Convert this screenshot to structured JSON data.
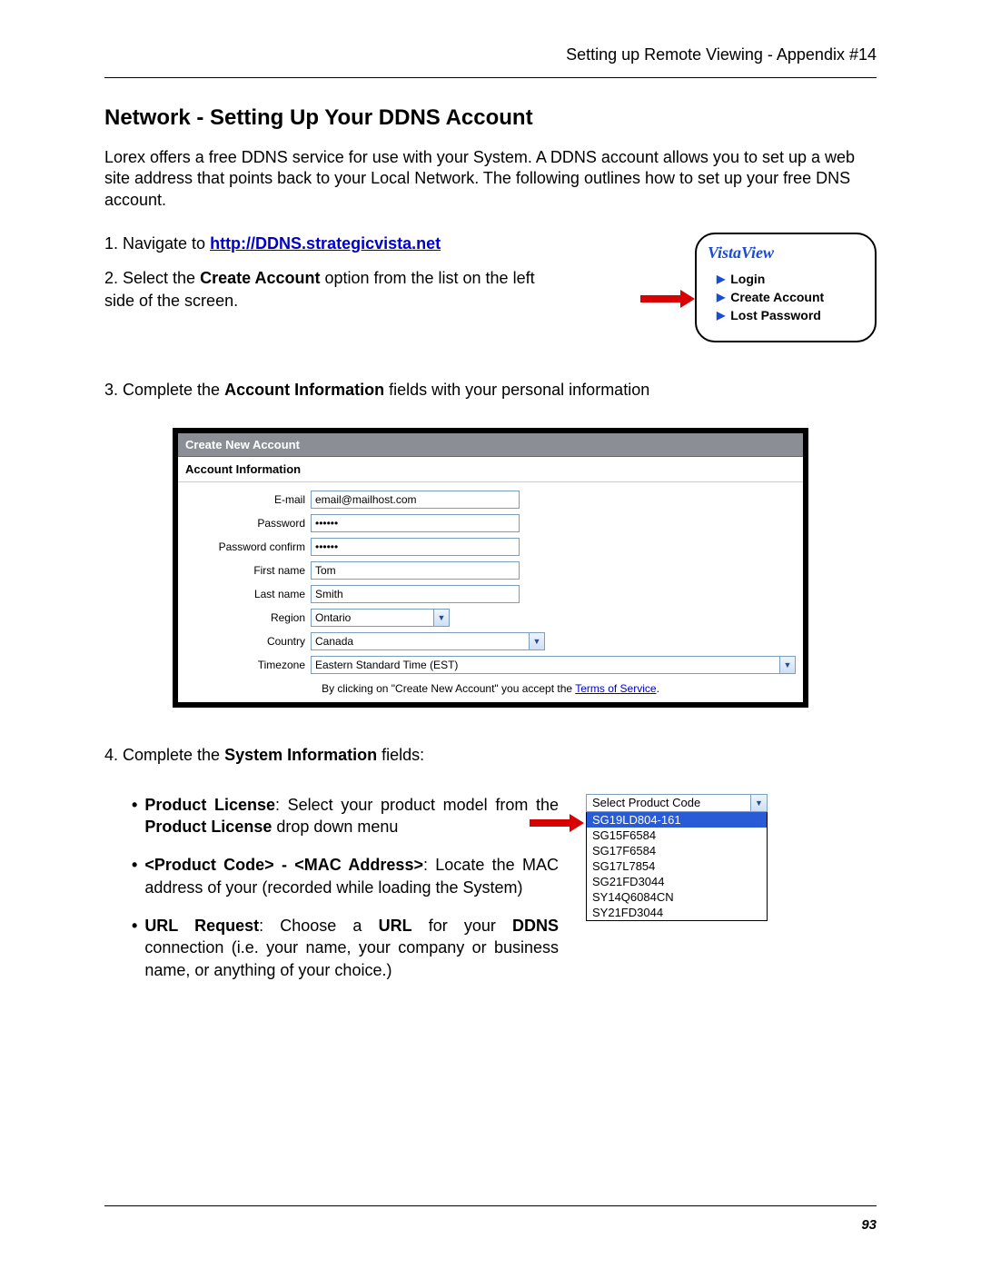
{
  "header": "Setting up Remote Viewing - Appendix #14",
  "title": "Network - Setting Up Your DDNS Account",
  "intro": "Lorex offers a free DDNS service for use with your System. A DDNS account allows you to set up a web site address that points back to your Local Network. The following outlines how to set up your free DNS account.",
  "step1_prefix": "1. Navigate to ",
  "step1_link": "http://DDNS.strategicvista.net",
  "step2_a": "2. Select the ",
  "step2_b": "Create Account",
  "step2_c": " option from the list on the left side of the screen.",
  "vista": {
    "title": "VistaView",
    "items": [
      "Login",
      "Create Account",
      "Lost Password"
    ]
  },
  "step3_a": "3. Complete the ",
  "step3_b": "Account Information",
  "step3_c": " fields with your personal information",
  "form": {
    "header": "Create New Account",
    "sub": "Account Information",
    "rows": {
      "email": {
        "label": "E-mail",
        "value": "email@mailhost.com"
      },
      "password": {
        "label": "Password",
        "value": "••••••"
      },
      "password_confirm": {
        "label": "Password confirm",
        "value": "••••••"
      },
      "first": {
        "label": "First name",
        "value": "Tom"
      },
      "last": {
        "label": "Last name",
        "value": "Smith"
      },
      "region": {
        "label": "Region",
        "value": "Ontario"
      },
      "country": {
        "label": "Country",
        "value": "Canada"
      },
      "tz": {
        "label": "Timezone",
        "value": "Eastern Standard Time (EST)"
      }
    },
    "tos_a": "By clicking on \"Create New Account\" you accept the ",
    "tos_link": "Terms of Service",
    "tos_b": "."
  },
  "step4_a": "4. Complete the ",
  "step4_b": "System Information",
  "step4_c": " fields:",
  "bullets": {
    "b1_a": "Product License",
    "b1_b": ": Select your product model from the ",
    "b1_c": "Product License",
    "b1_d": " drop down menu",
    "b2_a": "<Product Code> - <MAC Address>",
    "b2_b": ": Locate the MAC address of your (recorded while loading the System)",
    "b3_a": "URL Request",
    "b3_b": ": Choose a ",
    "b3_c": "URL",
    "b3_d": " for your ",
    "b3_e": "DDNS",
    "b3_f": " connection (i.e. your name, your company or business name, or anything of your choice.)"
  },
  "product_code": {
    "selected": "Select Product Code",
    "options": [
      "SG19LD804-161",
      "SG15F6584",
      "SG17F6584",
      "SG17L7854",
      "SG21FD3044",
      "SY14Q6084CN",
      "SY21FD3044"
    ]
  },
  "page_number": "93"
}
